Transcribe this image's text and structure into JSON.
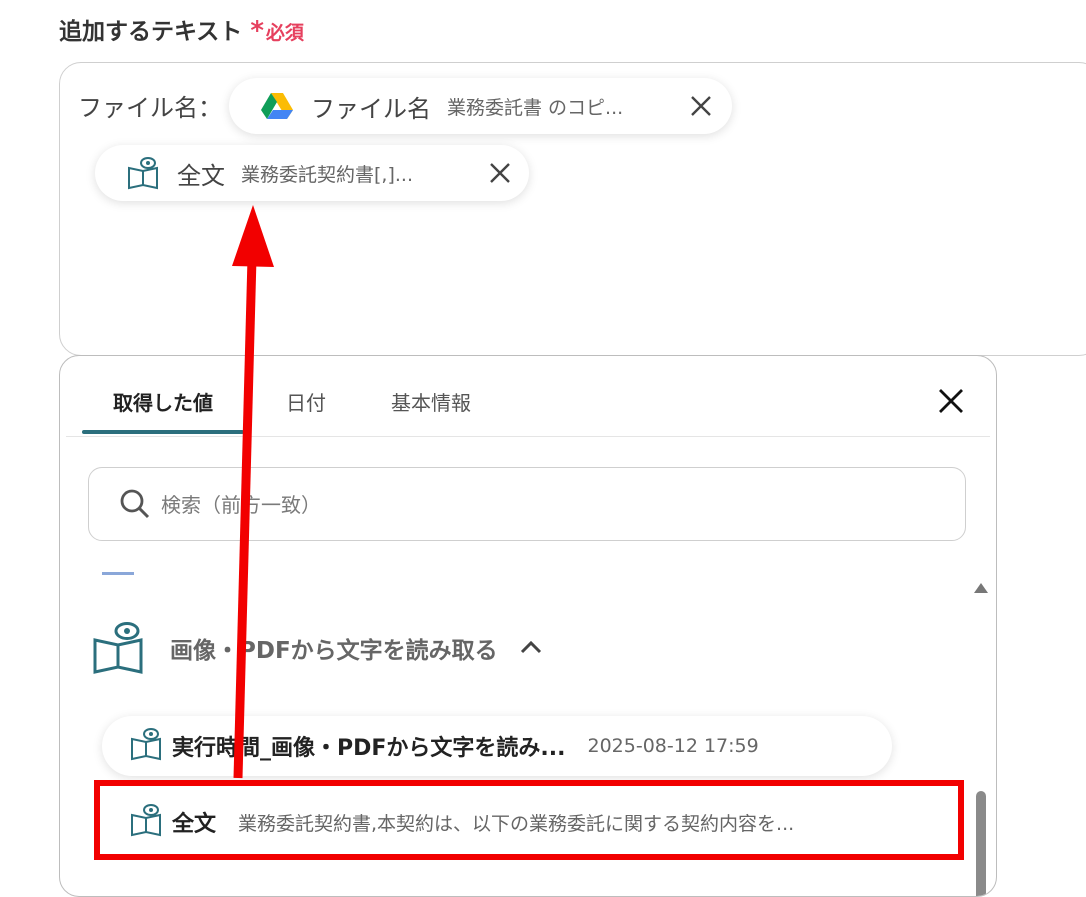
{
  "section": {
    "title": "追加するテキスト",
    "required_mark": "*",
    "required_label": "必須"
  },
  "text_field": {
    "static_label": "ファイル名：",
    "chips": [
      {
        "icon": "google-drive-icon",
        "title": "ファイル名",
        "value": "業務委託書 のコピ..."
      },
      {
        "icon": "book-eye-icon",
        "title": "全文",
        "value": "業務委託契約書[,]..."
      }
    ]
  },
  "picker": {
    "tabs": [
      {
        "label": "取得した値",
        "active": true
      },
      {
        "label": "日付",
        "active": false
      },
      {
        "label": "基本情報",
        "active": false
      }
    ],
    "search": {
      "placeholder": "検索（前方一致）",
      "value": ""
    },
    "group": {
      "icon": "book-eye-icon",
      "label": "画像・PDFから文字を読み取る",
      "expanded": true
    },
    "items": [
      {
        "icon": "book-eye-icon",
        "title": "実行時間_画像・PDFから文字を読み...",
        "value": "2025-08-12 17:59"
      },
      {
        "icon": "book-eye-icon",
        "title": "全文",
        "value": "業務委託契約書,本契約は、以下の業務委託に関する契約内容を..."
      }
    ]
  },
  "colors": {
    "required": "#e6405e",
    "tab_accent": "#2b6f7d",
    "annotation": "#f20000",
    "icon_teal": "#2b6f7d"
  }
}
